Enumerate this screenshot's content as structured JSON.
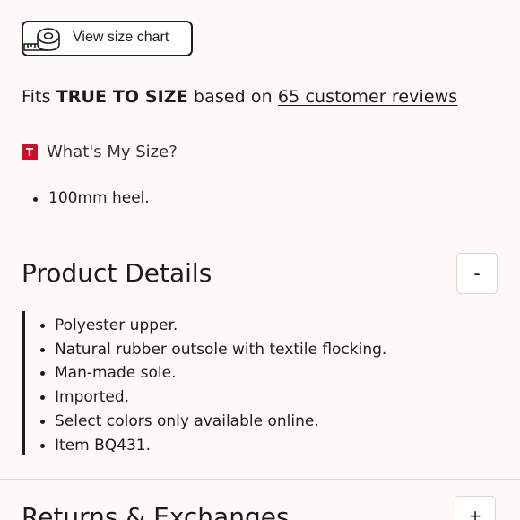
{
  "size_chart": {
    "label": "View size chart",
    "icon": "measuring-tape-icon"
  },
  "fit": {
    "prefix": "Fits",
    "emphasis": "TRUE TO SIZE",
    "middle": "based on",
    "link": "65 customer reviews"
  },
  "whats_my_size": {
    "badge": "T",
    "badge_color": "#c8102e",
    "link": "What's My Size?"
  },
  "features": [
    "100mm heel."
  ],
  "product_details": {
    "title": "Product Details",
    "toggle": "-",
    "items": [
      "Polyester upper.",
      "Natural rubber outsole with textile flocking.",
      "Man-made sole.",
      "Imported.",
      "Select colors only available online.",
      "Item BQ431."
    ]
  },
  "returns": {
    "title": "Returns & Exchanges",
    "toggle": "+"
  }
}
